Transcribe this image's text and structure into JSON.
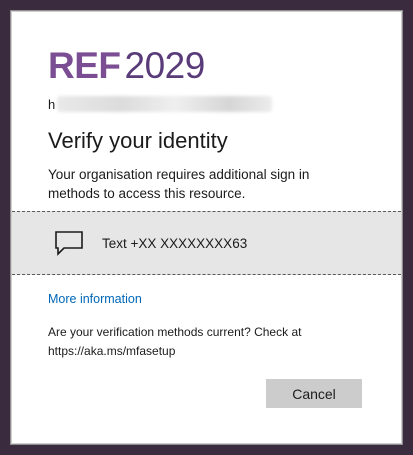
{
  "logo": {
    "ref_text": "REF",
    "year_text": "2029"
  },
  "account": {
    "visible_prefix": "h"
  },
  "title": "Verify your identity",
  "description": "Your organisation requires additional sign in methods to access this resource.",
  "method": {
    "icon": "message-icon",
    "label": "Text +XX XXXXXXXX63"
  },
  "links": {
    "more_information": "More information"
  },
  "verification_notice": {
    "line1": "Are your verification methods current? Check at",
    "line2": "https://aka.ms/mfasetup"
  },
  "buttons": {
    "cancel": "Cancel"
  },
  "colors": {
    "brand_purple": "#7b4d92",
    "link_blue": "#0067b8",
    "option_background": "#e6e6e6",
    "button_gray": "#cccccc"
  }
}
